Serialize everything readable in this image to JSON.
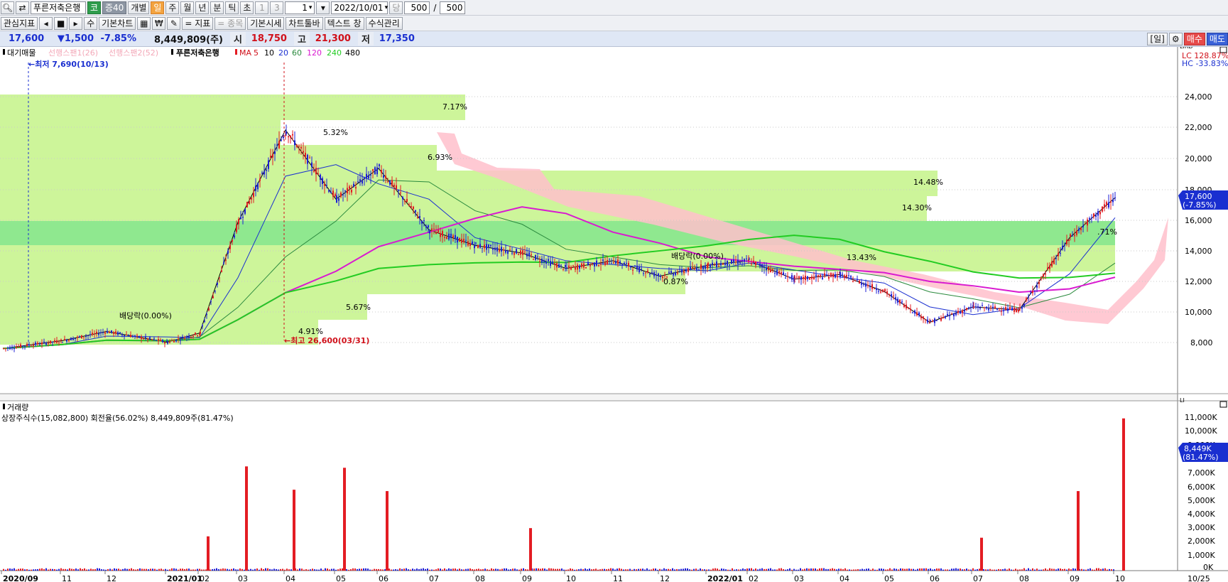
{
  "toolbar1": {
    "stock_name": "푸른저축은행",
    "badge_kospi": "코",
    "badge_credit": "증40",
    "btn_individual": "개별",
    "periods": [
      "일",
      "주",
      "월",
      "년",
      "분",
      "틱",
      "초"
    ],
    "minute_1": "1",
    "minute_3": "3",
    "interval_value": "1",
    "date_value": "2022/10/01",
    "btn_dang": "당",
    "count_value": "500",
    "slash": "/",
    "total_value": "500"
  },
  "toolbar2": {
    "btn_interest_indicator": "관심지표",
    "btn_su": "수",
    "btn_basic_chart": "기본차트",
    "btn_won": "₩",
    "btn_indicator": "= 지표",
    "btn_stock": "= 종목",
    "btn_basic_price": "기본시세",
    "btn_chart_toolbar": "차트툴바",
    "btn_text_window": "텍스트 창",
    "btn_formula_manager": "수식관리"
  },
  "pricebar": {
    "price": "17,600",
    "change": "▼1,500",
    "change_pct": "-7.85%",
    "volume": "8,449,809(주)",
    "open_label": "시",
    "open": "18,750",
    "high_label": "고",
    "high": "21,300",
    "low_label": "저",
    "low": "17,350",
    "btn_day": "[일]",
    "btn_buy": "매수",
    "btn_sell": "매도"
  },
  "price_panel": {
    "legend": {
      "label_supply": "대기매물",
      "label_span1": "선행스팬1(26)",
      "label_span2": "선행스팬2(52)",
      "label_stock": "푸른저축은행",
      "label_ma": "MA",
      "ma_periods": [
        "5",
        "10",
        "20",
        "60",
        "120",
        "240",
        "480"
      ]
    },
    "lowest_label": "←최저 7,690(10/13)",
    "highest_label": "←최고 26,600(03/31)",
    "lc_label": "LC 128.87%",
    "hc_label": "HC -33.83%",
    "current_price_tag": "17,600",
    "current_pct_tag": "(-7.85%)",
    "annotations": {
      "dividend1": "배당락(0.00%)",
      "dividend2": "배당락(0.00%)",
      "pct_717": "7.17%",
      "pct_532": "5.32%",
      "pct_693": "6.93%",
      "pct_1448": "14.48%",
      "pct_1430": "14.30%",
      "pct_1343": "13.43%",
      "pct_087": "0.87%",
      "pct_567": "5.67%",
      "pct_491": "4.91%",
      "pct_right": ".71%"
    },
    "y_labels": [
      "24,000",
      "22,000",
      "20,000",
      "18,000",
      "16,000",
      "14,000",
      "12,000",
      "10,000",
      "8,000"
    ]
  },
  "volume_panel": {
    "title": "거래량",
    "stats": "상장주식수(15,082,800) 회전율(56.02%) 8,449,809주(81.47%)",
    "current_tag": "8,449K",
    "current_pct": "(81.47%)",
    "y_labels": [
      "11,000K",
      "10,000K",
      "9,000K",
      "7,000K",
      "6,000K",
      "5,000K",
      "4,000K",
      "3,000K",
      "2,000K",
      "1,000K",
      "0K"
    ]
  },
  "x_axis": {
    "labels": [
      "2020/09",
      "11",
      "12",
      "2021/01",
      "02",
      "03",
      "04",
      "05",
      "06",
      "07",
      "08",
      "09",
      "10",
      "11",
      "12",
      "2022/01",
      "02",
      "03",
      "04",
      "05",
      "06",
      "07",
      "08",
      "09",
      "10"
    ],
    "right_label": "10/25"
  },
  "colors": {
    "candle_up": "#e31c23",
    "candle_down": "#1f1fd6",
    "supply_zone": "#cdf59a",
    "supply_zone_strong": "#8fe88f",
    "cloud": "#ffc0cb",
    "ma5": "#000000",
    "ma20": "#1a2fd0",
    "ma60": "#2b8a3e",
    "ma120": "#d91ad0",
    "ma240": "#22cc22"
  },
  "chart_data": {
    "type": "candlestick",
    "price_range": [
      7690,
      26600
    ],
    "series_points": [
      {
        "date": "2020/09",
        "close": 7800
      },
      {
        "date": "2020/11",
        "close": 8300
      },
      {
        "date": "2020/12",
        "close": 8900
      },
      {
        "date": "2021/01",
        "close": 8200
      },
      {
        "date": "2021/02",
        "close": 8800
      },
      {
        "date": "2021/03",
        "close": 16000
      },
      {
        "date": "2021/04",
        "close": 22000
      },
      {
        "date": "2021/05",
        "close": 17500
      },
      {
        "date": "2021/06",
        "close": 19500
      },
      {
        "date": "2021/07",
        "close": 15500
      },
      {
        "date": "2021/08",
        "close": 14500
      },
      {
        "date": "2021/09",
        "close": 14000
      },
      {
        "date": "2021/10",
        "close": 13000
      },
      {
        "date": "2021/11",
        "close": 13500
      },
      {
        "date": "2021/12",
        "close": 12500
      },
      {
        "date": "2022/01",
        "close": 13200
      },
      {
        "date": "2022/02",
        "close": 13500
      },
      {
        "date": "2022/03",
        "close": 12300
      },
      {
        "date": "2022/04",
        "close": 12600
      },
      {
        "date": "2022/05",
        "close": 11500
      },
      {
        "date": "2022/06",
        "close": 9500
      },
      {
        "date": "2022/07",
        "close": 10500
      },
      {
        "date": "2022/08",
        "close": 10300
      },
      {
        "date": "2022/09",
        "close": 15000
      },
      {
        "date": "2022/10",
        "close": 17600
      }
    ],
    "volume_points_k": [
      {
        "date": "2021/02",
        "value": 2500
      },
      {
        "date": "2021/03",
        "value": 7600
      },
      {
        "date": "2021/04",
        "value": 5900
      },
      {
        "date": "2021/05",
        "value": 7500
      },
      {
        "date": "2021/06",
        "value": 5800
      },
      {
        "date": "2021/09",
        "value": 3100
      },
      {
        "date": "2022/07",
        "value": 2400
      },
      {
        "date": "2022/09",
        "value": 5800
      },
      {
        "date": "2022/10",
        "value": 11100
      }
    ]
  }
}
